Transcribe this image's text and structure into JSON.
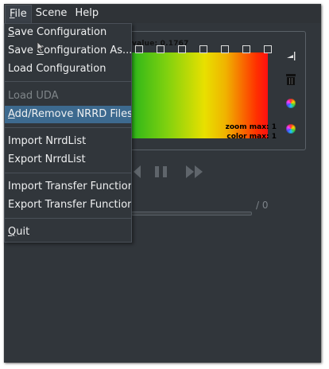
{
  "menubar": {
    "items": [
      {
        "pre": "",
        "ul": "F",
        "post": "ile"
      },
      {
        "pre": "",
        "ul": "S",
        "post": "cene"
      },
      {
        "pre": "",
        "ul": "H",
        "post": "elp"
      }
    ]
  },
  "file_menu": {
    "items": [
      {
        "pre": "",
        "ul": "S",
        "post": "ave Configuration",
        "enabled": true
      },
      {
        "pre": "Save ",
        "ul": "C",
        "post": "onfiguration As...",
        "enabled": true
      },
      {
        "pre": "",
        "ul": "",
        "post": "Load Configuration",
        "enabled": true
      },
      {
        "pre": "",
        "ul": "",
        "post": "Load UDA",
        "enabled": false
      },
      {
        "pre": "",
        "ul": "A",
        "post": "dd/Remove NRRD Files",
        "enabled": true,
        "highlighted": true
      },
      {
        "pre": "",
        "ul": "",
        "post": "Import NrrdList",
        "enabled": true
      },
      {
        "pre": "",
        "ul": "",
        "post": "Export NrrdList",
        "enabled": true
      },
      {
        "pre": "",
        "ul": "",
        "post": "Import Transfer Function",
        "enabled": true
      },
      {
        "pre": "",
        "ul": "",
        "post": "Export Transfer Function",
        "enabled": true
      },
      {
        "pre": "",
        "ul": "Q",
        "post": "uit",
        "enabled": true
      }
    ]
  },
  "transfer_function": {
    "value_label": "value: 0.1767",
    "zoom_max": "zoom max: 1",
    "color_max": "color max: 1",
    "gradient_colors": [
      "#22b21b",
      "#7fd10f",
      "#e8e000",
      "#f0b300",
      "#ff3000"
    ]
  },
  "playback": {
    "slider_label": "/ 0",
    "progress": 0
  },
  "icons": {
    "picker": "triangle-picker-icon",
    "trash": "trash-icon",
    "color1": "color-wheel-icon",
    "color2": "color-wheel-icon",
    "pause": "pause-icon",
    "fast_forward": "fast-forward-icon",
    "rewind": "rewind-icon"
  }
}
